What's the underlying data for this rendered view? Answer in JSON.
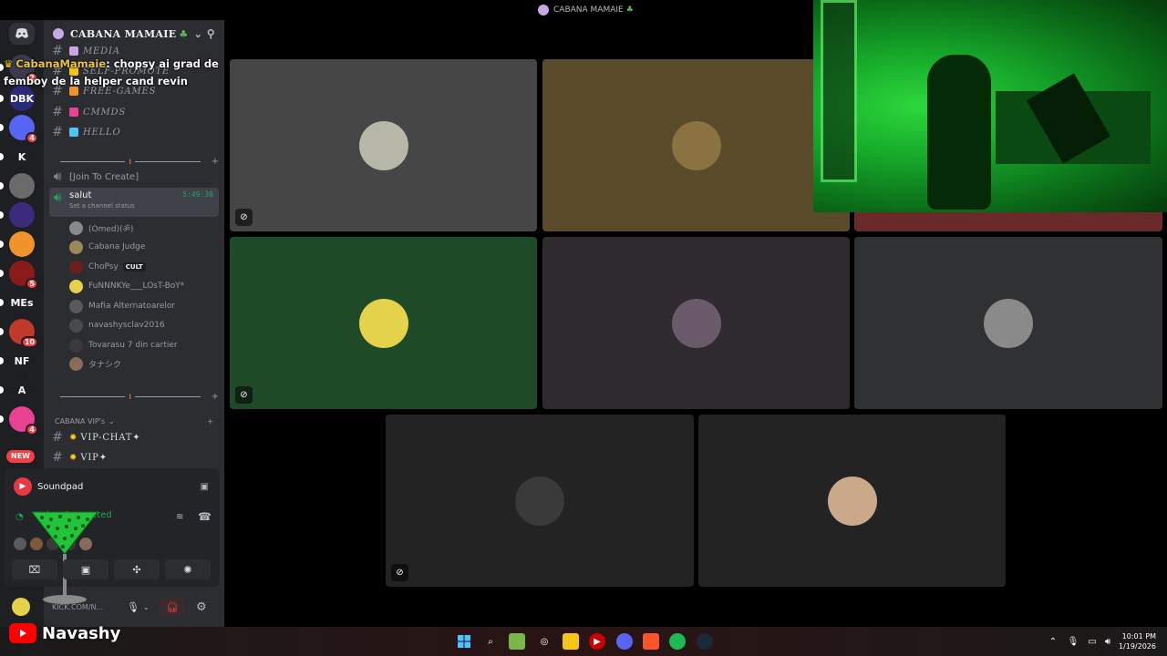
{
  "window": {
    "title": "CABANA MAMAIE",
    "server_name": "CABANA MAMAIE"
  },
  "chat_overlay": {
    "username": "CabanaMamaie",
    "message": ": chopsy ai grad de femboy de la helper cand revin"
  },
  "server_rail": {
    "new_badge": "NEW",
    "items": [
      {
        "label": "",
        "badge": "2",
        "color": "#3b3b4f"
      },
      {
        "label": "DBK",
        "badge": "",
        "color": "#2a2a7a"
      },
      {
        "label": "",
        "badge": "4",
        "color": "#5865f2"
      },
      {
        "label": "K",
        "badge": "",
        "color": "#1e1f22"
      },
      {
        "label": "",
        "badge": "",
        "color": "#6b6b6b"
      },
      {
        "label": "",
        "badge": "",
        "color": "#3c2a7a"
      },
      {
        "label": "",
        "badge": "",
        "color": "#f0932b"
      },
      {
        "label": "",
        "badge": "5",
        "color": "#8b1a1a"
      },
      {
        "label": "MEs",
        "badge": "",
        "color": "#1e1f22"
      },
      {
        "label": "",
        "badge": "10",
        "color": "#c0392b"
      },
      {
        "label": "NF",
        "badge": "",
        "color": "#1e1f22"
      },
      {
        "label": "A",
        "badge": "",
        "color": "#1e1f22"
      },
      {
        "label": "",
        "badge": "4",
        "color": "#e84393"
      }
    ]
  },
  "channels": {
    "text_top": [
      {
        "name": "MEDIA",
        "emoji_color": "#c9a6e8"
      },
      {
        "name": "SELF-PROMOTE",
        "emoji_color": "#f5c518"
      },
      {
        "name": "FREE-GAMES",
        "emoji_color": "#f0932b"
      },
      {
        "name": "CMMDS",
        "emoji_color": "#e84393"
      },
      {
        "name": "HELLO",
        "emoji_color": "#4fc3f7"
      }
    ],
    "join_to_create": "[Join To Create]",
    "active_voice": {
      "name": "salut",
      "time": "5:49:38",
      "status": "Set a channel status"
    },
    "voice_users": [
      {
        "name": "(Omed)(ॐ)",
        "tag": "",
        "avatar": "#8a8a8a"
      },
      {
        "name": "Cabana Judge",
        "tag": "",
        "avatar": "#9a8a5a"
      },
      {
        "name": "ChoPsy",
        "tag": "CULT",
        "avatar": "#6b1f1f"
      },
      {
        "name": "FuNNNKYe___LOsT-BoY*",
        "tag": "",
        "avatar": "#e3d24a"
      },
      {
        "name": "Mafia Alternatoarelor",
        "tag": "",
        "avatar": "#5a5a5a"
      },
      {
        "name": "navashysclav2016",
        "tag": "",
        "avatar": "#4a4a4a"
      },
      {
        "name": "Tovarasu 7 din cartier",
        "tag": "",
        "avatar": "#3a3a3a"
      },
      {
        "name": "タナシク",
        "tag": "",
        "avatar": "#8a6a5a"
      }
    ],
    "vip_category": "CABANA VIP's",
    "vip_channels": [
      {
        "name": "VIP-CHAT✦"
      },
      {
        "name": "VIP✦"
      }
    ]
  },
  "voice_panel": {
    "app_name": "Soundpad",
    "status": "Voice Connected",
    "user_status": "KICK.COM/N..."
  },
  "tiles": [
    {
      "bg": "#464646",
      "avatar": "#b7b7a7",
      "muted": true
    },
    {
      "bg": "#5a4c2a",
      "avatar": "#8b7341",
      "muted": false
    },
    {
      "bg": "#6a2a2a",
      "avatar": "#7a3a3a",
      "muted": false
    },
    {
      "bg": "#1f4a28",
      "avatar": "#e3d24a",
      "muted": true
    },
    {
      "bg": "#2e2a2e",
      "avatar": "#6b5a6b",
      "muted": false
    },
    {
      "bg": "#2f3133",
      "avatar": "#8a8a8a",
      "muted": false
    },
    {
      "bg": "#232323",
      "avatar": "#3a3a3a",
      "muted": true
    },
    {
      "bg": "#232323",
      "avatar": "#c9a98a",
      "muted": false
    }
  ],
  "branding": {
    "channel_name": "Navashy"
  },
  "taskbar": {
    "time": "10:01 PM",
    "date": "1/19/2026"
  },
  "colors": {
    "discord_bg": "#2b2d31",
    "rail_bg": "#1e1f22",
    "voice_green": "#23a55a",
    "webcam_green": "#16a82a"
  }
}
